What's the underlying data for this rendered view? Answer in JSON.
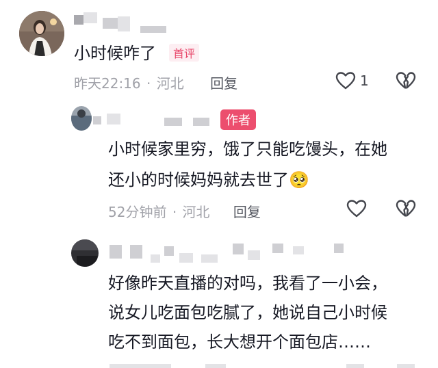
{
  "comment": {
    "text": "小时候咋了",
    "badge": "首评",
    "time": "昨天22:16",
    "location": "河北",
    "reply_label": "回复",
    "like_count": "1",
    "separator": "·"
  },
  "reply1": {
    "badge": "作者",
    "line1": "小时候家里穷，饿了只能吃馒头，在她",
    "line2": "还小的时候妈妈就去世了",
    "emoji": "🥺",
    "time": "52分钟前",
    "location": "河北",
    "reply_label": "回复",
    "separator": "·"
  },
  "reply2": {
    "line1": "好像昨天直播的对吗，我看了一小会，",
    "line2": "说女儿吃面包吃腻了，她说自己小时候",
    "line3": "吃不到面包，长大想开个面包店……"
  },
  "colors": {
    "accent": "#ec4e6e",
    "meta_text": "#a0a1a8",
    "body_text": "#161823"
  }
}
